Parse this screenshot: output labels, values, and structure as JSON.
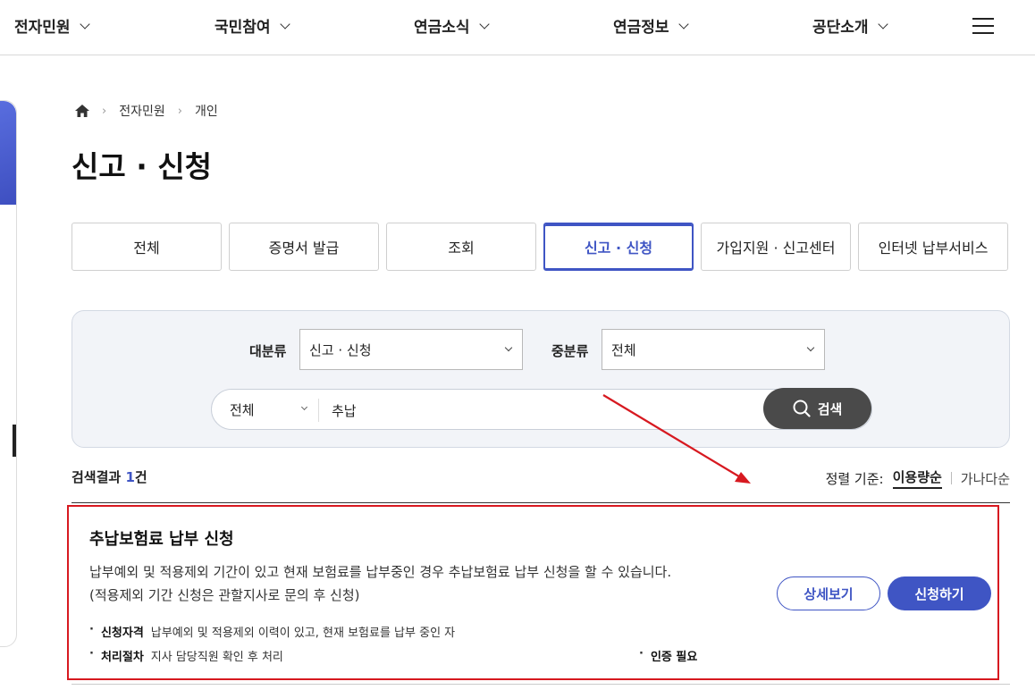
{
  "nav": {
    "items": [
      {
        "label": "전자민원"
      },
      {
        "label": "국민참여"
      },
      {
        "label": "연금소식"
      },
      {
        "label": "연금정보"
      },
      {
        "label": "공단소개"
      }
    ],
    "menu_icon": "hamburger-icon"
  },
  "breadcrumb": {
    "home_icon": "home-icon",
    "items": [
      "전자민원",
      "개인"
    ]
  },
  "page_title": "신고 · 신청",
  "tabs": [
    {
      "label": "전체",
      "active": false
    },
    {
      "label": "증명서 발급",
      "active": false
    },
    {
      "label": "조회",
      "active": false
    },
    {
      "label": "신고 · 신청",
      "active": true
    },
    {
      "label": "가입지원 · 신고센터",
      "active": false
    },
    {
      "label": "인터넷 납부서비스",
      "active": false
    }
  ],
  "filters": {
    "major_label": "대분류",
    "major_value": "신고 · 신청",
    "minor_label": "중분류",
    "minor_value": "전체",
    "scope_value": "전체",
    "query": "추납",
    "search_button": "검색"
  },
  "results": {
    "count_prefix": "검색결과 ",
    "count": "1",
    "count_suffix": "건",
    "sort_label": "정렬 기준:",
    "sort_active": "이용량순",
    "sort_other": "가나다순"
  },
  "card": {
    "title": "추납보험료 납부 신청",
    "desc_line1": "납부예외 및 적용제외 기간이 있고 현재 보험료를 납부중인 경우 추납보험료 납부 신청을 할 수 있습니다.",
    "desc_line2": "(적용제외 기간 신청은 관할지사로 문의 후 신청)",
    "detail_button": "상세보기",
    "apply_button": "신청하기",
    "eligibility_key": "신청자격",
    "eligibility_value": "납부예외 및 적용제외 이력이 있고, 현재 보험료를 납부 중인 자",
    "process_key": "처리절차",
    "process_value": "지사 담당직원 확인 후 처리",
    "auth_note": "인증 필요"
  },
  "colors": {
    "accent": "#3f55c4",
    "highlight_border": "#d71920",
    "annotation_arrow": "#d71920"
  }
}
